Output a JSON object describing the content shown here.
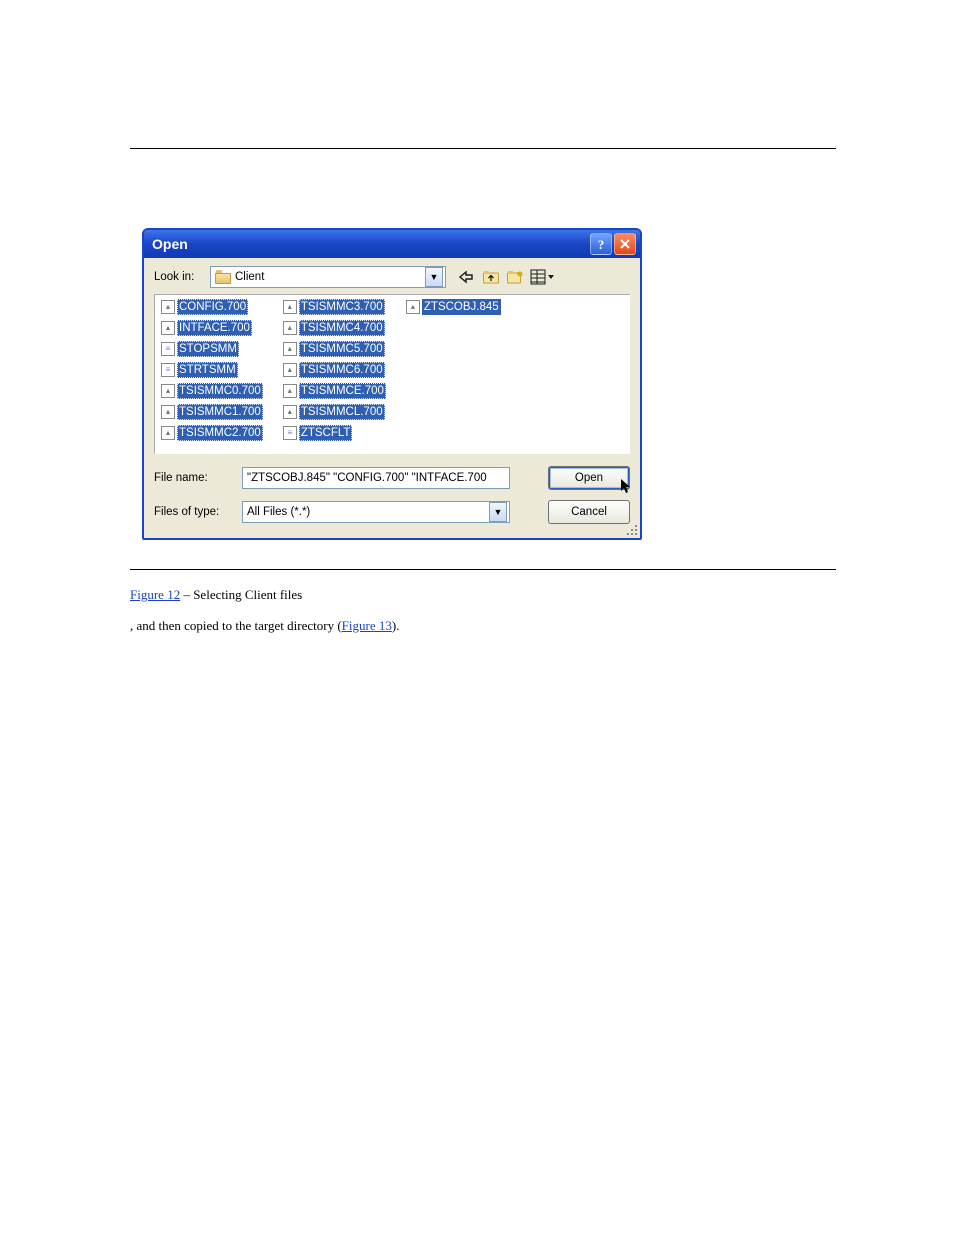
{
  "dialog": {
    "title": "Open",
    "look_in_label": "Look in:",
    "look_in_value": "Client",
    "file_name_label": "File name:",
    "file_name_value": "\"ZTSCOBJ.845\" \"CONFIG.700\" \"INTFACE.700",
    "file_type_label": "Files of type:",
    "file_type_value": "All Files (*.*)",
    "open_button": "Open",
    "cancel_button": "Cancel"
  },
  "files": {
    "col1": [
      {
        "name": "CONFIG.700",
        "icon": "img",
        "selected": true
      },
      {
        "name": "INTFACE.700",
        "icon": "img",
        "selected": true
      },
      {
        "name": "STOPSMM",
        "icon": "txt",
        "selected": true
      },
      {
        "name": "STRTSMM",
        "icon": "txt",
        "selected": true
      },
      {
        "name": "TSISMMC0.700",
        "icon": "img",
        "selected": true
      },
      {
        "name": "TSISMMC1.700",
        "icon": "img",
        "selected": true
      },
      {
        "name": "TSISMMC2.700",
        "icon": "img",
        "selected": true
      }
    ],
    "col2": [
      {
        "name": "TSISMMC3.700",
        "icon": "img",
        "selected": true
      },
      {
        "name": "TSISMMC4.700",
        "icon": "img",
        "selected": true
      },
      {
        "name": "TSISMMC5.700",
        "icon": "img",
        "selected": true
      },
      {
        "name": "TSISMMC6.700",
        "icon": "img",
        "selected": true
      },
      {
        "name": "TSISMMCE.700",
        "icon": "img",
        "selected": true
      },
      {
        "name": "TSISMMCL.700",
        "icon": "img",
        "selected": true
      },
      {
        "name": "ZTSCFLT",
        "icon": "txt",
        "selected": true
      }
    ],
    "col3": [
      {
        "name": "ZTSCOBJ.845",
        "icon": "img",
        "selected": true,
        "boxed": true
      }
    ]
  },
  "body": {
    "line1_link": "Figure 12",
    "line1_rest": " – Selecting Client files",
    "line2_pre": ", and then copied to the target directory (",
    "line2_link": "Figure 13",
    "line2_post": ")."
  }
}
